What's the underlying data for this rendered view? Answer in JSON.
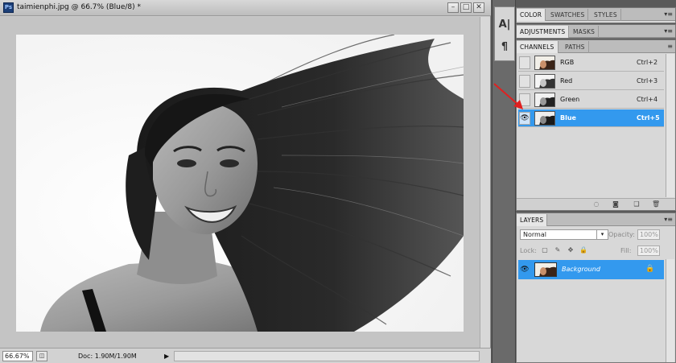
{
  "document": {
    "title": "taimienphi.jpg @ 66.7% (Blue/8) *",
    "app_icon": "Ps",
    "zoom": "66.67%",
    "doc_info": "Doc: 1.90M/1.90M"
  },
  "tools": {
    "character_glyph": "A|",
    "paragraph_glyph": "¶"
  },
  "color_panel": {
    "tabs": [
      "COLOR",
      "SWATCHES",
      "STYLES"
    ]
  },
  "adjustments_panel": {
    "tabs": [
      "ADJUSTMENTS",
      "MASKS"
    ]
  },
  "channels_panel": {
    "tabs": [
      "CHANNELS",
      "PATHS"
    ],
    "rows": [
      {
        "name": "RGB",
        "shortcut": "Ctrl+2",
        "visible": false
      },
      {
        "name": "Red",
        "shortcut": "Ctrl+3",
        "visible": false
      },
      {
        "name": "Green",
        "shortcut": "Ctrl+4",
        "visible": false
      },
      {
        "name": "Blue",
        "shortcut": "Ctrl+5",
        "visible": true
      }
    ]
  },
  "layers_panel": {
    "tabs": [
      "LAYERS"
    ],
    "blend_mode": "Normal",
    "opacity_label": "Opacity:",
    "opacity_value": "100%",
    "lock_label": "Lock:",
    "fill_label": "Fill:",
    "fill_value": "100%",
    "layer_name": "Background"
  },
  "colors": {
    "selection": "#3399ee",
    "arrow": "#e02020"
  }
}
